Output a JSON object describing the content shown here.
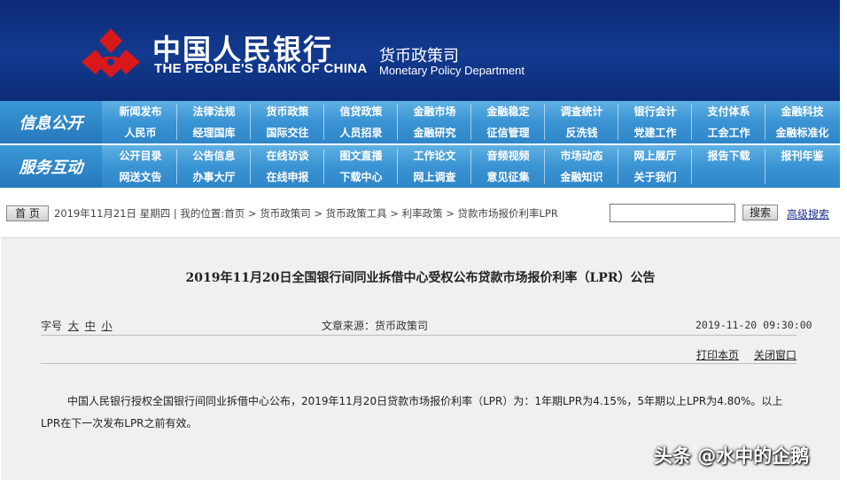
{
  "header": {
    "cn_name": "中国人民银行",
    "en_name": "THE PEOPLE'S BANK OF CHINA",
    "dept_cn": "货币政策司",
    "dept_en": "Monetary Policy Department",
    "logo": "pboc-emblem-icon",
    "colors": {
      "banner": "#123a8f",
      "logo_red": "#d7191c"
    }
  },
  "nav": {
    "section1": "信息公开",
    "section2": "服务互动",
    "row1": [
      "新闻发布",
      "法律法规",
      "货币政策",
      "信贷政策",
      "金融市场",
      "金融稳定",
      "调查统计",
      "银行会计",
      "支付体系",
      "金融科技"
    ],
    "row2": [
      "人民币",
      "经理国库",
      "国际交往",
      "人员招录",
      "金融研究",
      "征信管理",
      "反洗钱",
      "党建工作",
      "工会工作",
      "金融标准化"
    ],
    "row3": [
      "公开目录",
      "公告信息",
      "在线访谈",
      "图文直播",
      "工作论文",
      "音频视频",
      "市场动态",
      "网上展厅",
      "报告下载",
      "报刊年鉴"
    ],
    "row4": [
      "网送文告",
      "办事大厅",
      "在线申报",
      "下载中心",
      "网上调查",
      "意见征集",
      "金融知识",
      "关于我们"
    ],
    "colors": {
      "band": "#3a93d3",
      "section": "#2677bb"
    }
  },
  "crumb": {
    "home_label": "首 页",
    "text": "2019年11月21日 星期四 | 我的位置:首页 > 货币政策司 > 货币政策工具 > 利率政策 > 贷款市场报价利率LPR",
    "search_placeholder": "",
    "search_label": "搜索",
    "advanced_label": "高级搜索"
  },
  "article": {
    "title": "2019年11月20日全国银行间同业拆借中心受权公布贷款市场报价利率（LPR）公告",
    "font_size_label": "字号",
    "size_large": "大",
    "size_medium": "中",
    "size_small": "小",
    "source": "文章来源：货币政策司",
    "datetime": "2019-11-20 09:30:00",
    "print_label": "打印本页",
    "close_label": "关闭窗口",
    "body": "中国人民银行授权全国银行间同业拆借中心公布，2019年11月20日贷款市场报价利率（LPR）为：1年期LPR为4.15%，5年期以上LPR为4.80%。以上LPR在下一次发布LPR之前有效。"
  },
  "watermark": "头条 @水中的企鹅"
}
